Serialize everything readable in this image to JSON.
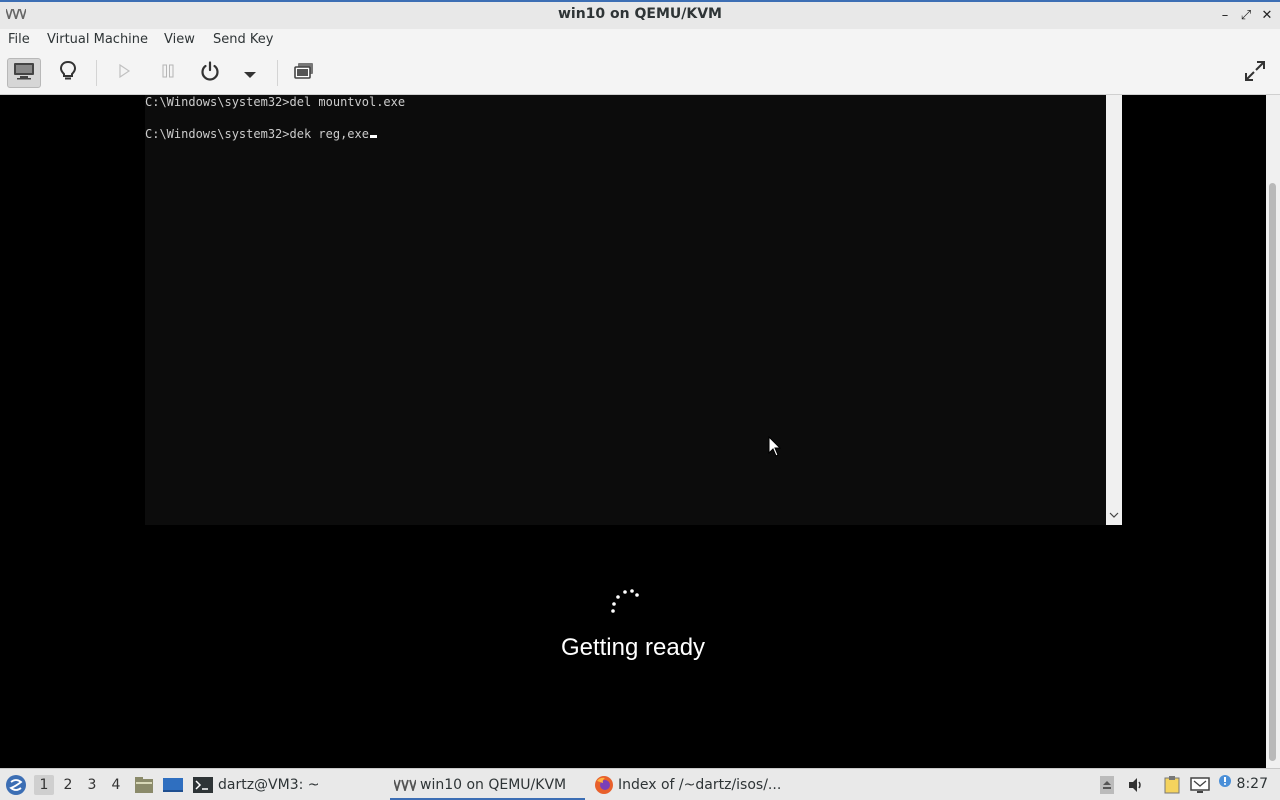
{
  "window": {
    "title": "win10 on QEMU/KVM",
    "controls": {
      "minimize": "–",
      "maximize": "⤢",
      "close": "✕"
    }
  },
  "menu": {
    "items": [
      "File",
      "Virtual Machine",
      "View",
      "Send Key"
    ]
  },
  "toolbar": {
    "buttons": [
      "console-icon",
      "lightbulb-icon",
      "play-icon",
      "pause-icon",
      "power-icon",
      "dropdown-arrow-icon",
      "snapshots-icon",
      "fullscreen-icon"
    ]
  },
  "console": {
    "lines": [
      "C:\\Windows\\system32>del mountvol.exe",
      "C:\\Windows\\system32>dek reg,exe"
    ]
  },
  "status": {
    "getting_ready": "Getting ready"
  },
  "taskbar": {
    "workspaces": [
      "1",
      "2",
      "3",
      "4"
    ],
    "active_workspace": "1",
    "tasks": [
      {
        "label": "dartz@VM3: ~",
        "icon": "terminal-icon"
      },
      {
        "label": "win10 on QEMU/KVM",
        "icon": "virt-manager-icon"
      },
      {
        "label": "Index of /~dartz/isos/...",
        "icon": "firefox-icon"
      }
    ],
    "clock": "8:27"
  },
  "colors": {
    "accent": "#3c6eb4",
    "console_bg": "#0c0c0c",
    "console_text": "#cccccc"
  }
}
